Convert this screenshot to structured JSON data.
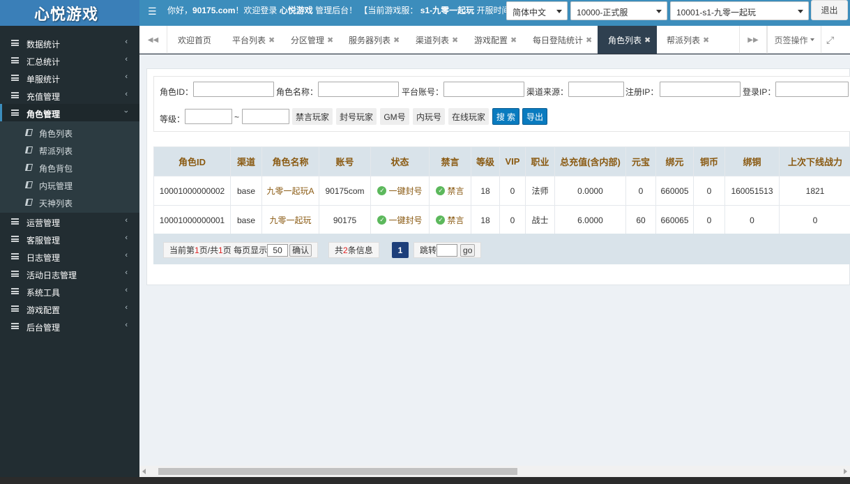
{
  "header": {
    "logo": "心悦游戏",
    "welcome_prefix": "你好，",
    "user": "90175.com",
    "welcome_mid": "！欢迎登录 ",
    "system_name": "心悦游戏",
    "welcome_suffix": " 管理后台！ 【当前游戏服： ",
    "current_server": "s1-九零一起玩",
    "welcome_tail": " 开服时间",
    "language": "简体中文",
    "environment": "10000-正式服",
    "server": "10001-s1-九零一起玩",
    "logout": "退出"
  },
  "sidebar": {
    "items": [
      {
        "label": "数据统计",
        "icon": "menu-icon"
      },
      {
        "label": "汇总统计",
        "icon": "menu-icon"
      },
      {
        "label": "单服统计",
        "icon": "menu-icon"
      },
      {
        "label": "充值管理",
        "icon": "menu-icon"
      },
      {
        "label": "角色管理",
        "icon": "menu-icon",
        "active": true
      },
      {
        "label": "运营管理",
        "icon": "menu-icon"
      },
      {
        "label": "客服管理",
        "icon": "menu-icon"
      },
      {
        "label": "日志管理",
        "icon": "menu-icon"
      },
      {
        "label": "活动日志管理",
        "icon": "menu-icon"
      },
      {
        "label": "系统工具",
        "icon": "menu-icon"
      },
      {
        "label": "游戏配置",
        "icon": "menu-icon"
      },
      {
        "label": "后台管理",
        "icon": "menu-icon"
      }
    ],
    "sub_items": [
      {
        "label": "角色列表",
        "icon": "book-icon"
      },
      {
        "label": "帮派列表",
        "icon": "book-icon"
      },
      {
        "label": "角色背包",
        "icon": "book-icon"
      },
      {
        "label": "内玩管理",
        "icon": "book-icon"
      },
      {
        "label": "天神列表",
        "icon": "book-icon"
      }
    ]
  },
  "tabs": {
    "items": [
      {
        "label": "欢迎首页",
        "closable": false
      },
      {
        "label": "平台列表",
        "closable": true
      },
      {
        "label": "分区管理",
        "closable": true
      },
      {
        "label": "服务器列表",
        "closable": true
      },
      {
        "label": "渠道列表",
        "closable": true
      },
      {
        "label": "游戏配置",
        "closable": true
      },
      {
        "label": "每日登陆统计",
        "closable": true
      },
      {
        "label": "角色列表",
        "closable": true,
        "active": true
      },
      {
        "label": "帮派列表",
        "closable": true
      }
    ],
    "ops_label": "页签操作"
  },
  "search": {
    "role_id_label": "角色ID：",
    "role_name_label": "角色名称：",
    "account_label": "平台账号：",
    "channel_label": "渠道来源：",
    "reg_ip_label": "注册IP：",
    "login_ip_label": "登录IP：",
    "level_label": "等级：",
    "range_sep": "~",
    "buttons": {
      "muted": "禁言玩家",
      "banned": "封号玩家",
      "gm": "GM号",
      "internal": "内玩号",
      "online": "在线玩家",
      "search": "搜 索",
      "export": "导出"
    }
  },
  "table": {
    "headers": [
      "角色ID",
      "渠道",
      "角色名称",
      "账号",
      "状态",
      "禁言",
      "等级",
      "VIP",
      "职业",
      "总充值(含内部)",
      "元宝",
      "绑元",
      "铜币",
      "绑铜",
      "上次下线战力"
    ],
    "rows": [
      {
        "role_id": "10001000000002",
        "channel": "base",
        "name": "九零一起玩A",
        "account": "90175com",
        "status": "一键封号",
        "mute": "禁言",
        "level": "18",
        "vip": "0",
        "job": "法师",
        "recharge": "0.0000",
        "yuanbao": "0",
        "bind_yuan": "660005",
        "copper": "0",
        "bind_copper": "160051513",
        "power": "1821"
      },
      {
        "role_id": "10001000000001",
        "channel": "base",
        "name": "九零一起玩",
        "account": "90175",
        "status": "一键封号",
        "mute": "禁言",
        "level": "18",
        "vip": "0",
        "job": "战士",
        "recharge": "6.0000",
        "yuanbao": "60",
        "bind_yuan": "660065",
        "copper": "0",
        "bind_copper": "0",
        "power": "0"
      }
    ]
  },
  "pager": {
    "prefix": "当前第 ",
    "current": "1",
    "mid1": " 页/共 ",
    "total": "1",
    "mid2": " 页 每页显示",
    "per_page": "50",
    "confirm": "确认",
    "records_prefix": "共",
    "records": "2",
    "records_suffix": "条信息",
    "active_page": "1",
    "jump_label": "跳转",
    "go": "go"
  },
  "colors": {
    "topbar": "#3c8dbc",
    "sidebar": "#222d32",
    "active_tab": "#2f4050",
    "table_header_bg": "#d9e3ea",
    "table_header_text": "#8a5a12",
    "search_button": "#0a7bbf",
    "status_icon": "#5cb85c"
  }
}
